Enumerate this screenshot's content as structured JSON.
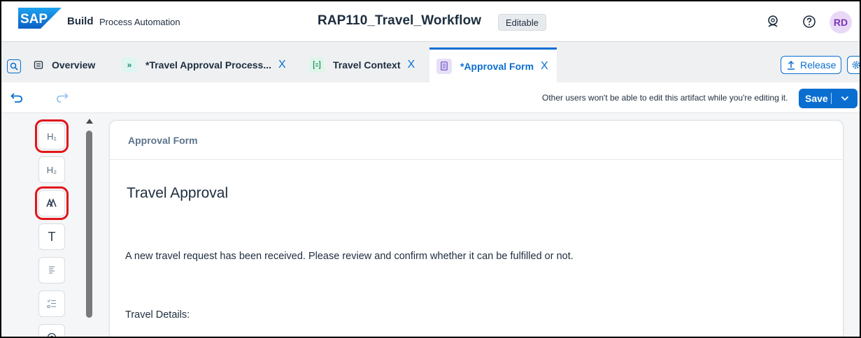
{
  "shell": {
    "logo_text": "SAP",
    "product_strong": "Build",
    "product_sub": "Process Automation",
    "artifact_title": "RAP110_Travel_Workflow",
    "status_badge": "Editable",
    "avatar_initials": "RD",
    "icons": [
      "joule-assistant-icon",
      "help-icon"
    ]
  },
  "tabs": [
    {
      "label": "Overview",
      "icon": "overview-icon",
      "closable": false,
      "active": false
    },
    {
      "label": "*Travel Approval Process...",
      "icon": "process-icon",
      "closable": true,
      "active": false
    },
    {
      "label": "Travel Context",
      "icon": "context-icon",
      "closable": true,
      "active": false
    },
    {
      "label": "*Approval Form",
      "icon": "form-icon",
      "closable": true,
      "active": true
    }
  ],
  "tab_close_glyph": "X",
  "tabbar_actions": {
    "release_label": "Release"
  },
  "toolbar": {
    "edit_notice": "Other users won't be able to edit this artifact while you're editing it.",
    "save_label": "Save"
  },
  "palette": {
    "items": [
      {
        "label": "H₁",
        "name": "heading-1-control",
        "highlighted": true
      },
      {
        "label": "H₂",
        "name": "heading-2-control",
        "highlighted": false
      },
      {
        "label": "",
        "name": "paragraph-style-control",
        "highlighted": true
      },
      {
        "label": "T",
        "name": "text-input-control",
        "highlighted": false
      },
      {
        "label": "",
        "name": "text-area-control",
        "highlighted": false
      },
      {
        "label": "",
        "name": "checklist-control",
        "highlighted": false
      },
      {
        "label": "",
        "name": "radio-control",
        "highlighted": false
      }
    ]
  },
  "form": {
    "card_title": "Approval Form",
    "heading": "Travel Approval",
    "paragraph": "A new travel request has been received. Please review and confirm whether it can be fulfilled or not.",
    "section_label": "Travel Details:"
  },
  "colors": {
    "accent": "#0a6ed1",
    "highlight_box": "#e0161b",
    "avatar_bg": "#e9d9f7",
    "avatar_text": "#7a35b6"
  }
}
